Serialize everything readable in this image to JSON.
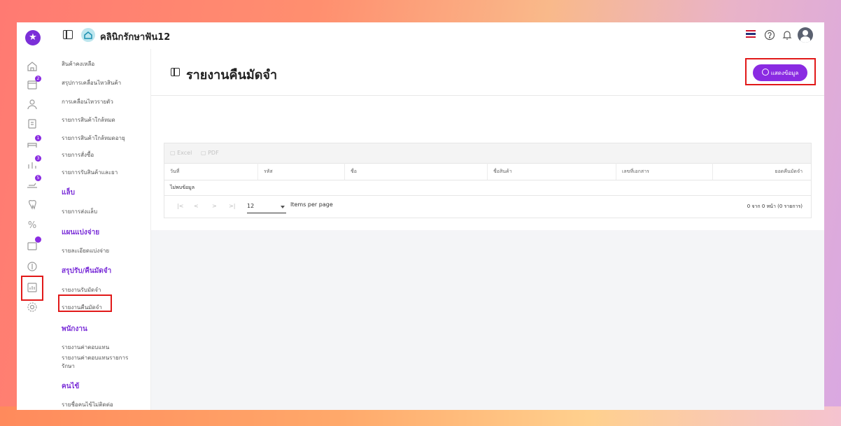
{
  "header": {
    "clinic_name": "คลินิกรักษาฟัน12"
  },
  "rail": {
    "badges": [
      "2",
      "1",
      "3",
      "5",
      ""
    ]
  },
  "submenu": {
    "top_items": [
      "สินค้าคงเหลือ",
      "สรุปการเคลื่อนไหวสินค้า",
      "การเคลื่อนไหวรายตัว",
      "รายการสินค้าใกล้หมด",
      "รายการสินค้าใกล้หมดอายุ",
      "รายการสั่งซื้อ",
      "รายการรับสินค้าและยา"
    ],
    "lab_head": "แล็บ",
    "lab_items": [
      "รายการส่งแล็บ"
    ],
    "plan_head": "แผนแบ่งจ่าย",
    "plan_items": [
      "รายละเอียดแบ่งจ่าย"
    ],
    "deposit_head": "สรุปรับ/คืนมัดจำ",
    "deposit_items": [
      "รายงานรับมัดจำ",
      "รายงานคืนมัดจำ"
    ],
    "staff_head": "พนักงาน",
    "staff_items": [
      "รายงานค่าตอบแทน",
      "รายงานค่าตอบแทนรายการ",
      "รักษา"
    ],
    "patient_head": "คนไข้",
    "patient_items": [
      "รายชื่อคนไข้ไม่ติดต่อ"
    ]
  },
  "page": {
    "title": "รายงานคืนมัดจำ",
    "show_button": "แสดงข้อมูล"
  },
  "table": {
    "tools": [
      "Excel",
      "PDF"
    ],
    "columns": [
      "วันที่",
      "รหัส",
      "ชื่อ",
      "ชื่อสินค้า",
      "เลขที่เอกสาร",
      "ยอดคืนมัดจำ"
    ],
    "empty_text": "ไม่พบข้อมูล",
    "per_page": "12",
    "per_page_label": "Items per page",
    "range_text": "0 จาก 0 หน้า (0 รายการ)",
    "pager_glyphs": [
      "|<",
      "<",
      ">",
      ">|"
    ]
  },
  "colors": {
    "accent": "#8a2be2",
    "highlight": "#e11919"
  }
}
